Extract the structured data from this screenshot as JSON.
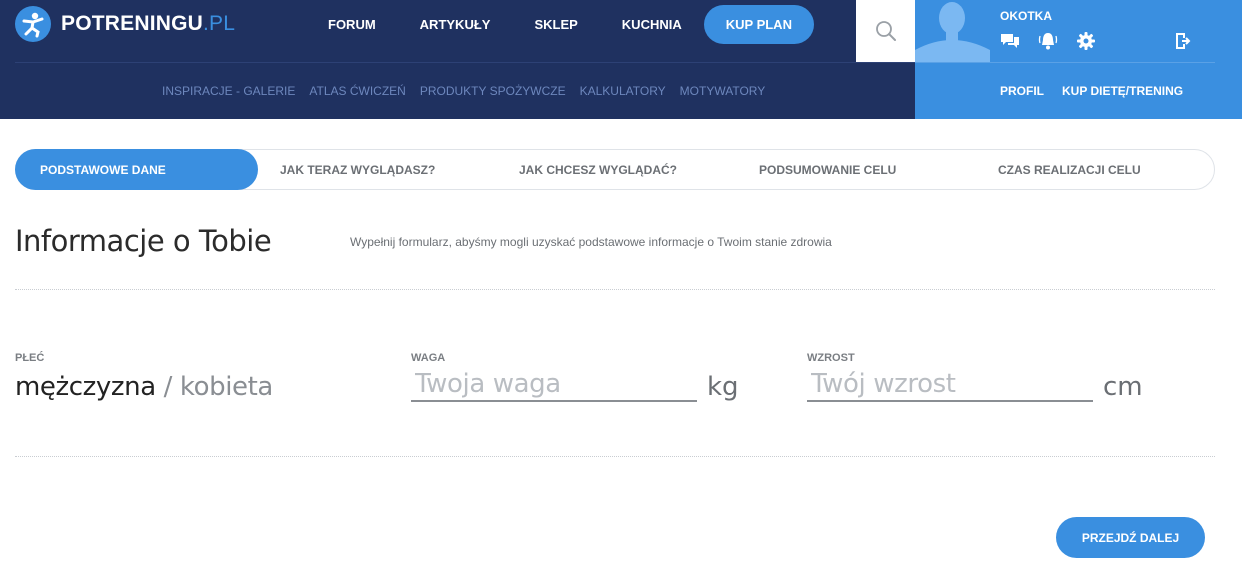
{
  "header": {
    "logo_text": "POTRENINGU",
    "logo_suffix": ".PL",
    "nav": [
      "FORUM",
      "ARTYKUŁY",
      "SKLEP",
      "KUCHNIA"
    ],
    "buy_plan": "KUP PLAN",
    "subnav": [
      "INSPIRACJE - GALERIE",
      "ATLAS ĆWICZEŃ",
      "PRODUKTY SPOŻYWCZE",
      "KALKULATORY",
      "MOTYWATORY"
    ]
  },
  "user": {
    "name": "OKOTKA",
    "icons": [
      "chat-icon",
      "bell-icon",
      "gear-icon",
      "logout-icon"
    ],
    "links": [
      "PROFIL",
      "KUP DIETĘ/TRENING"
    ]
  },
  "steps": [
    "PODSTAWOWE DANE",
    "JAK TERAZ WYGLĄDASZ?",
    "JAK CHCESZ WYGLĄDAĆ?",
    "PODSUMOWANIE CELU",
    "CZAS REALIZACJI CELU"
  ],
  "form": {
    "title": "Informacje o Tobie",
    "description": "Wypełnij formularz, abyśmy mogli uzyskać podstawowe informacje o Twoim stanie zdrowia",
    "gender_label": "PŁEĆ",
    "gender_male": "mężczyzna",
    "gender_sep": " / ",
    "gender_female": "kobieta",
    "weight_label": "WAGA",
    "weight_placeholder": "Twoja waga",
    "weight_unit": "kg",
    "height_label": "WZROST",
    "height_placeholder": "Twój wzrost",
    "height_unit": "cm",
    "next_button": "PRZEJDŹ DALEJ"
  },
  "colors": {
    "header_bg": "#1f3160",
    "accent": "#3a8fe0",
    "subnav_text": "#6d87bd"
  }
}
